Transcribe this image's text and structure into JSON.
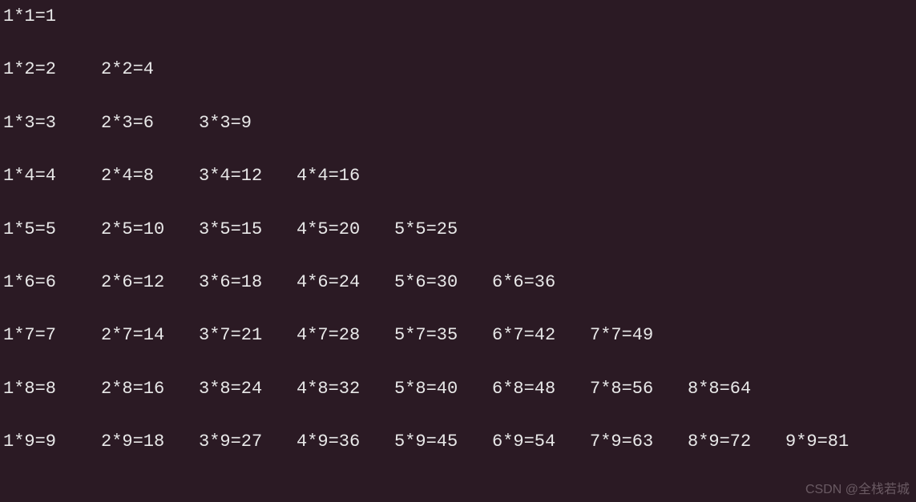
{
  "multiplication_table": {
    "rows": [
      [
        {
          "a": 1,
          "b": 1,
          "r": 1
        }
      ],
      [
        {
          "a": 1,
          "b": 2,
          "r": 2
        },
        {
          "a": 2,
          "b": 2,
          "r": 4
        }
      ],
      [
        {
          "a": 1,
          "b": 3,
          "r": 3
        },
        {
          "a": 2,
          "b": 3,
          "r": 6
        },
        {
          "a": 3,
          "b": 3,
          "r": 9
        }
      ],
      [
        {
          "a": 1,
          "b": 4,
          "r": 4
        },
        {
          "a": 2,
          "b": 4,
          "r": 8
        },
        {
          "a": 3,
          "b": 4,
          "r": 12
        },
        {
          "a": 4,
          "b": 4,
          "r": 16
        }
      ],
      [
        {
          "a": 1,
          "b": 5,
          "r": 5
        },
        {
          "a": 2,
          "b": 5,
          "r": 10
        },
        {
          "a": 3,
          "b": 5,
          "r": 15
        },
        {
          "a": 4,
          "b": 5,
          "r": 20
        },
        {
          "a": 5,
          "b": 5,
          "r": 25
        }
      ],
      [
        {
          "a": 1,
          "b": 6,
          "r": 6
        },
        {
          "a": 2,
          "b": 6,
          "r": 12
        },
        {
          "a": 3,
          "b": 6,
          "r": 18
        },
        {
          "a": 4,
          "b": 6,
          "r": 24
        },
        {
          "a": 5,
          "b": 6,
          "r": 30
        },
        {
          "a": 6,
          "b": 6,
          "r": 36
        }
      ],
      [
        {
          "a": 1,
          "b": 7,
          "r": 7
        },
        {
          "a": 2,
          "b": 7,
          "r": 14
        },
        {
          "a": 3,
          "b": 7,
          "r": 21
        },
        {
          "a": 4,
          "b": 7,
          "r": 28
        },
        {
          "a": 5,
          "b": 7,
          "r": 35
        },
        {
          "a": 6,
          "b": 7,
          "r": 42
        },
        {
          "a": 7,
          "b": 7,
          "r": 49
        }
      ],
      [
        {
          "a": 1,
          "b": 8,
          "r": 8
        },
        {
          "a": 2,
          "b": 8,
          "r": 16
        },
        {
          "a": 3,
          "b": 8,
          "r": 24
        },
        {
          "a": 4,
          "b": 8,
          "r": 32
        },
        {
          "a": 5,
          "b": 8,
          "r": 40
        },
        {
          "a": 6,
          "b": 8,
          "r": 48
        },
        {
          "a": 7,
          "b": 8,
          "r": 56
        },
        {
          "a": 8,
          "b": 8,
          "r": 64
        }
      ],
      [
        {
          "a": 1,
          "b": 9,
          "r": 9
        },
        {
          "a": 2,
          "b": 9,
          "r": 18
        },
        {
          "a": 3,
          "b": 9,
          "r": 27
        },
        {
          "a": 4,
          "b": 9,
          "r": 36
        },
        {
          "a": 5,
          "b": 9,
          "r": 45
        },
        {
          "a": 6,
          "b": 9,
          "r": 54
        },
        {
          "a": 7,
          "b": 9,
          "r": 63
        },
        {
          "a": 8,
          "b": 9,
          "r": 72
        },
        {
          "a": 9,
          "b": 9,
          "r": 81
        }
      ]
    ]
  },
  "watermark": "CSDN @全栈若城"
}
